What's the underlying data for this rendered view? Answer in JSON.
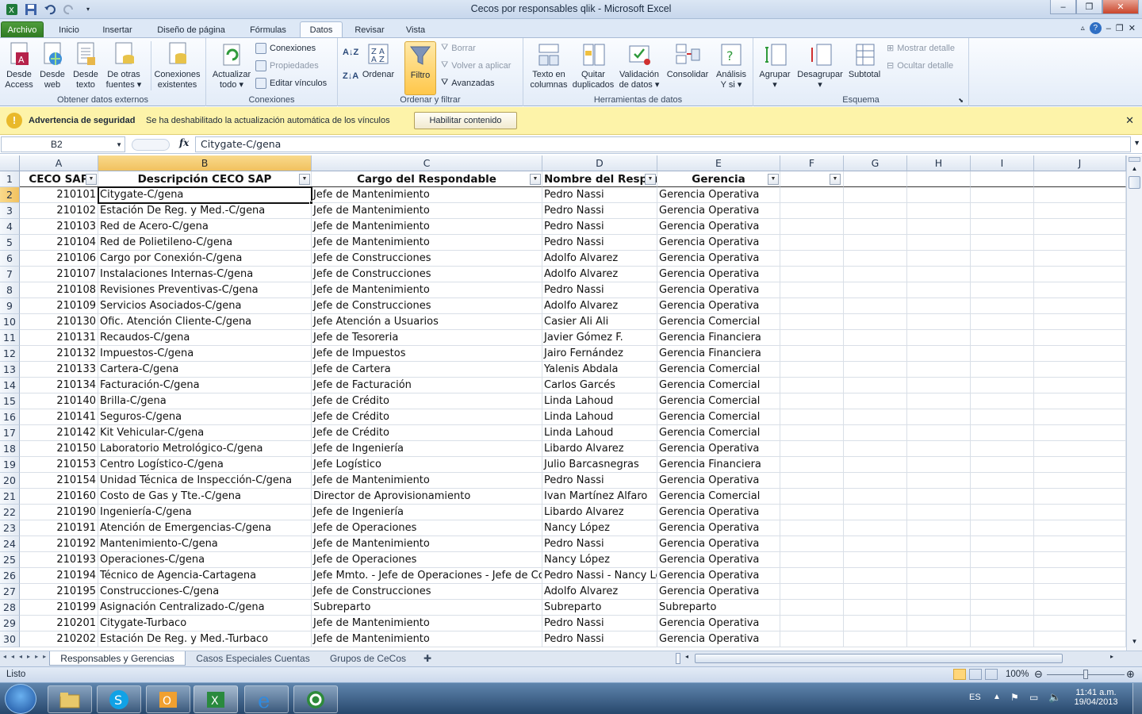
{
  "window": {
    "title": "Cecos por responsables qlik  -  Microsoft Excel"
  },
  "ribbon_tabs": [
    "Archivo",
    "Inicio",
    "Insertar",
    "Diseño de página",
    "Fórmulas",
    "Datos",
    "Revisar",
    "Vista"
  ],
  "ribbon": {
    "obtener": {
      "label": "Obtener datos externos",
      "desde_access": [
        "Desde",
        "Access"
      ],
      "desde_web": [
        "Desde",
        "web"
      ],
      "desde_texto": [
        "Desde",
        "texto"
      ],
      "otras": [
        "De otras",
        "fuentes"
      ],
      "conexiones_existentes": [
        "Conexiones",
        "existentes"
      ]
    },
    "conexiones": {
      "label": "Conexiones",
      "actualizar": [
        "Actualizar",
        "todo"
      ],
      "conexiones": "Conexiones",
      "propiedades": "Propiedades",
      "editar": "Editar vínculos"
    },
    "ordenar": {
      "label": "Ordenar y filtrar",
      "ordenar": "Ordenar",
      "filtro": "Filtro",
      "borrar": "Borrar",
      "volver": "Volver a aplicar",
      "avanzadas": "Avanzadas"
    },
    "herramientas": {
      "label": "Herramientas de datos",
      "texto_columnas": [
        "Texto en",
        "columnas"
      ],
      "quitar_duplicados": [
        "Quitar",
        "duplicados"
      ],
      "validacion": [
        "Validación",
        "de datos"
      ],
      "consolidar": "Consolidar",
      "analisis": [
        "Análisis",
        "Y si"
      ]
    },
    "esquema": {
      "label": "Esquema",
      "agrupar": "Agrupar",
      "desagrupar": "Desagrupar",
      "subtotal": "Subtotal",
      "mostrar": "Mostrar detalle",
      "ocultar": "Ocultar detalle"
    }
  },
  "security_bar": {
    "title": "Advertencia de seguridad",
    "message": "Se ha deshabilitado la actualización automática de los vínculos",
    "button": "Habilitar contenido"
  },
  "formula_bar": {
    "name_box": "B2",
    "fx": "fx",
    "formula": "Citygate-C/gena"
  },
  "columns": [
    "A",
    "B",
    "C",
    "D",
    "E",
    "F",
    "G",
    "H",
    "I",
    "J"
  ],
  "header_row": [
    "CECO SAP",
    "Descripción CECO SAP",
    "Cargo del Respondable",
    "Nombre del Respon",
    "Gerencia"
  ],
  "rows": [
    [
      "210101",
      "Citygate-C/gena",
      "Jefe de Mantenimiento",
      "Pedro Nassi",
      "Gerencia Operativa"
    ],
    [
      "210102",
      "Estación De Reg. y Med.-C/gena",
      "Jefe de Mantenimiento",
      "Pedro Nassi",
      "Gerencia Operativa"
    ],
    [
      "210103",
      "Red de Acero-C/gena",
      "Jefe de Mantenimiento",
      "Pedro Nassi",
      "Gerencia Operativa"
    ],
    [
      "210104",
      "Red de Polietileno-C/gena",
      "Jefe de Mantenimiento",
      "Pedro Nassi",
      "Gerencia Operativa"
    ],
    [
      "210106",
      "Cargo por Conexión-C/gena",
      "Jefe de Construcciones",
      "Adolfo Alvarez",
      "Gerencia Operativa"
    ],
    [
      "210107",
      "Instalaciones Internas-C/gena",
      "Jefe de Construcciones",
      "Adolfo Alvarez",
      "Gerencia Operativa"
    ],
    [
      "210108",
      "Revisiones Preventivas-C/gena",
      "Jefe de Mantenimiento",
      "Pedro Nassi",
      "Gerencia Operativa"
    ],
    [
      "210109",
      "Servicios Asociados-C/gena",
      "Jefe de Construcciones",
      "Adolfo Alvarez",
      "Gerencia Operativa"
    ],
    [
      "210130",
      "Ofic. Atención Cliente-C/gena",
      "Jefe Atención a Usuarios",
      "Casier Ali Ali",
      "Gerencia Comercial"
    ],
    [
      "210131",
      "Recaudos-C/gena",
      "Jefe de Tesoreria",
      "Javier Gómez F.",
      "Gerencia Financiera"
    ],
    [
      "210132",
      "Impuestos-C/gena",
      "Jefe de Impuestos",
      "Jairo Fernández",
      "Gerencia Financiera"
    ],
    [
      "210133",
      "Cartera-C/gena",
      "Jefe de Cartera",
      "Yalenis Abdala",
      "Gerencia Comercial"
    ],
    [
      "210134",
      "Facturación-C/gena",
      "Jefe de Facturación",
      "Carlos Garcés",
      "Gerencia Comercial"
    ],
    [
      "210140",
      "Brilla-C/gena",
      "Jefe de Crédito",
      "Linda Lahoud",
      "Gerencia Comercial"
    ],
    [
      "210141",
      "Seguros-C/gena",
      "Jefe de Crédito",
      "Linda Lahoud",
      "Gerencia Comercial"
    ],
    [
      "210142",
      "Kit Vehicular-C/gena",
      "Jefe de Crédito",
      "Linda Lahoud",
      "Gerencia Comercial"
    ],
    [
      "210150",
      "Laboratorio Metrológico-C/gena",
      "Jefe de Ingeniería",
      "Libardo Alvarez",
      "Gerencia Operativa"
    ],
    [
      "210153",
      "Centro Logístico-C/gena",
      "Jefe Logístico",
      "Julio Barcasnegras",
      "Gerencia Financiera"
    ],
    [
      "210154",
      "Unidad Técnica de Inspección-C/gena",
      "Jefe de Mantenimiento",
      "Pedro Nassi",
      "Gerencia Operativa"
    ],
    [
      "210160",
      "Costo de Gas y Tte.-C/gena",
      "Director de Aprovisionamiento",
      "Ivan Martínez Alfaro",
      "Gerencia Comercial"
    ],
    [
      "210190",
      "Ingeniería-C/gena",
      "Jefe de Ingeniería",
      "Libardo Alvarez",
      "Gerencia Operativa"
    ],
    [
      "210191",
      "Atención de Emergencias-C/gena",
      "Jefe de Operaciones",
      "Nancy López",
      "Gerencia Operativa"
    ],
    [
      "210192",
      "Mantenimiento-C/gena",
      "Jefe de Mantenimiento",
      "Pedro Nassi",
      "Gerencia Operativa"
    ],
    [
      "210193",
      "Operaciones-C/gena",
      "Jefe de Operaciones",
      "Nancy López",
      "Gerencia Operativa"
    ],
    [
      "210194",
      "Técnico de Agencia-Cartagena",
      "Jefe Mmto. - Jefe de Operaciones - Jefe de Constr",
      "Pedro Nassi - Nancy Lóp",
      "Gerencia Operativa"
    ],
    [
      "210195",
      "Construcciones-C/gena",
      "Jefe de Construcciones",
      "Adolfo Alvarez",
      "Gerencia Operativa"
    ],
    [
      "210199",
      "Asignación Centralizado-C/gena",
      "Subreparto",
      "Subreparto",
      "Subreparto"
    ],
    [
      "210201",
      "Citygate-Turbaco",
      "Jefe de Mantenimiento",
      "Pedro Nassi",
      "Gerencia Operativa"
    ],
    [
      "210202",
      "Estación De Reg. y Med.-Turbaco",
      "Jefe de Mantenimiento",
      "Pedro Nassi",
      "Gerencia Operativa"
    ]
  ],
  "sheet_tabs": [
    "Responsables y Gerencias",
    "Casos Especiales Cuentas",
    "Grupos de CeCos"
  ],
  "status": {
    "ready": "Listo",
    "zoom": "100%"
  },
  "taskbar": {
    "lang": "ES",
    "time": "11:41 a.m.",
    "date": "19/04/2013"
  }
}
